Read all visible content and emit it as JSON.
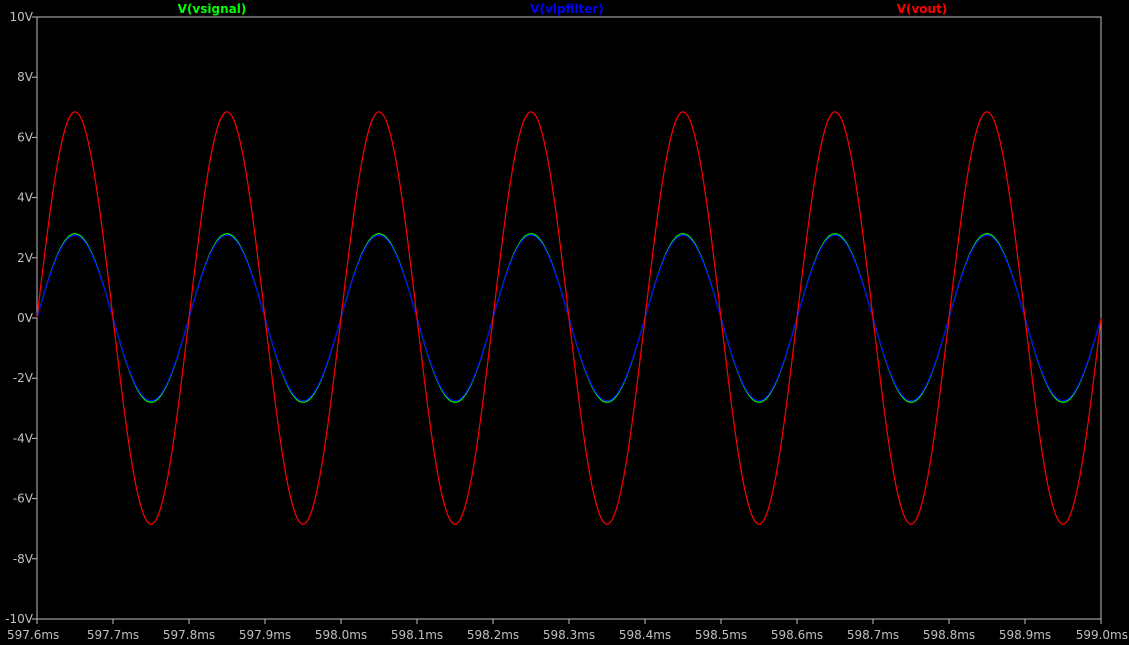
{
  "chart_data": {
    "type": "line",
    "xlabel": "",
    "ylabel": "",
    "xlim": [
      597.6,
      599.0
    ],
    "ylim": [
      -10,
      10
    ],
    "x_unit": "ms",
    "y_unit": "V",
    "x_ticks": [
      "597.6ms",
      "597.7ms",
      "597.8ms",
      "597.9ms",
      "598.0ms",
      "598.1ms",
      "598.2ms",
      "598.3ms",
      "598.4ms",
      "598.5ms",
      "598.6ms",
      "598.7ms",
      "598.8ms",
      "598.9ms",
      "599.0ms"
    ],
    "y_ticks": [
      "10V",
      "8V",
      "6V",
      "4V",
      "2V",
      "0V",
      "-2V",
      "-4V",
      "-6V",
      "-8V",
      "-10V"
    ],
    "x_tick_values": [
      597.6,
      597.7,
      597.8,
      597.9,
      598.0,
      598.1,
      598.2,
      598.3,
      598.4,
      598.5,
      598.6,
      598.7,
      598.8,
      598.9,
      599.0
    ],
    "y_tick_values": [
      10,
      8,
      6,
      4,
      2,
      0,
      -2,
      -4,
      -6,
      -8,
      -10
    ],
    "grid": false,
    "legend_placement": "top",
    "background": "#000000",
    "axis_color": "#c0c0c0",
    "series": [
      {
        "name": "V(vsignal)",
        "color": "#00ff00",
        "x": [
          597.6,
          597.625,
          597.65,
          597.675,
          597.7,
          597.725,
          597.75,
          597.775,
          597.8,
          597.825,
          597.85,
          597.875,
          597.9,
          597.925,
          597.95,
          597.975,
          598.0,
          598.025,
          598.05,
          598.075,
          598.1,
          598.125,
          598.15,
          598.175,
          598.2,
          598.225,
          598.25,
          598.275,
          598.3,
          598.325,
          598.35,
          598.375,
          598.4,
          598.425,
          598.45,
          598.475,
          598.5,
          598.525,
          598.55,
          598.575,
          598.6,
          598.625,
          598.65,
          598.675,
          598.7,
          598.725,
          598.75,
          598.775,
          598.8,
          598.825,
          598.85,
          598.875,
          598.9,
          598.925,
          598.95,
          598.975,
          599.0
        ],
        "y": [
          0,
          1.99,
          2.8,
          1.99,
          0,
          -1.99,
          -2.8,
          -1.99,
          0,
          1.99,
          2.8,
          1.99,
          0,
          -1.99,
          -2.8,
          -1.99,
          0,
          1.99,
          2.8,
          1.99,
          0,
          -1.99,
          -2.8,
          -1.99,
          0,
          1.99,
          2.8,
          1.99,
          0,
          -1.99,
          -2.8,
          -1.99,
          0,
          1.99,
          2.8,
          1.99,
          0,
          -1.99,
          -2.8,
          -1.99,
          0,
          1.99,
          2.8,
          1.99,
          0,
          -1.99,
          -2.8,
          -1.99,
          0,
          1.99,
          2.8,
          1.99,
          0,
          -1.99,
          -2.8,
          -1.99,
          0
        ]
      },
      {
        "name": "V(vlpfilter)",
        "color": "#0000ff",
        "x": [
          597.6,
          597.625,
          597.65,
          597.675,
          597.7,
          597.725,
          597.75,
          597.775,
          597.8,
          597.825,
          597.85,
          597.875,
          597.9,
          597.925,
          597.95,
          597.975,
          598.0,
          598.025,
          598.05,
          598.075,
          598.1,
          598.125,
          598.15,
          598.175,
          598.2,
          598.225,
          598.25,
          598.275,
          598.3,
          598.325,
          598.35,
          598.375,
          598.4,
          598.425,
          598.45,
          598.475,
          598.5,
          598.525,
          598.55,
          598.575,
          598.6,
          598.625,
          598.65,
          598.675,
          598.7,
          598.725,
          598.75,
          598.775,
          598.8,
          598.825,
          598.85,
          598.875,
          598.9,
          598.925,
          598.95,
          598.975,
          599.0
        ],
        "y": [
          0,
          1.96,
          2.75,
          1.96,
          0,
          -1.96,
          -2.75,
          -1.96,
          0,
          1.96,
          2.75,
          1.96,
          0,
          -1.96,
          -2.75,
          -1.96,
          0,
          1.96,
          2.75,
          1.96,
          0,
          -1.96,
          -2.75,
          -1.96,
          0,
          1.96,
          2.75,
          1.96,
          0,
          -1.96,
          -2.75,
          -1.96,
          0,
          1.96,
          2.75,
          1.96,
          0,
          -1.96,
          -2.75,
          -1.96,
          0,
          1.96,
          2.75,
          1.96,
          0,
          -1.96,
          -2.75,
          -1.96,
          0,
          1.96,
          2.75,
          1.96,
          0,
          -1.96,
          -2.75,
          -1.96,
          0
        ]
      },
      {
        "name": "V(vout)",
        "color": "#ff0000",
        "x": [
          597.6,
          597.625,
          597.65,
          597.675,
          597.7,
          597.725,
          597.75,
          597.775,
          597.8,
          597.825,
          597.85,
          597.875,
          597.9,
          597.925,
          597.95,
          597.975,
          598.0,
          598.025,
          598.05,
          598.075,
          598.1,
          598.125,
          598.15,
          598.175,
          598.2,
          598.225,
          598.25,
          598.275,
          598.3,
          598.325,
          598.35,
          598.375,
          598.4,
          598.425,
          598.45,
          598.475,
          598.5,
          598.525,
          598.55,
          598.575,
          598.6,
          598.625,
          598.65,
          598.675,
          598.7,
          598.725,
          598.75,
          598.775,
          598.8,
          598.825,
          598.85,
          598.875,
          598.9,
          598.925,
          598.95,
          598.975,
          599.0
        ],
        "y": [
          0,
          4.84,
          6.85,
          4.84,
          0,
          -4.84,
          -6.85,
          -4.84,
          0,
          4.84,
          6.85,
          4.84,
          0,
          -4.84,
          -6.85,
          -4.84,
          0,
          4.84,
          6.85,
          4.84,
          0,
          -4.84,
          -6.85,
          -4.84,
          0,
          4.84,
          6.85,
          4.84,
          0,
          -4.84,
          -6.85,
          -4.84,
          0,
          4.84,
          6.85,
          4.84,
          0,
          -4.84,
          -6.85,
          -4.84,
          0,
          4.84,
          6.85,
          4.84,
          0,
          -4.84,
          -6.85,
          -4.84,
          0,
          4.84,
          6.85,
          4.84,
          0,
          -4.84,
          -6.85,
          -4.84,
          0
        ]
      }
    ]
  }
}
